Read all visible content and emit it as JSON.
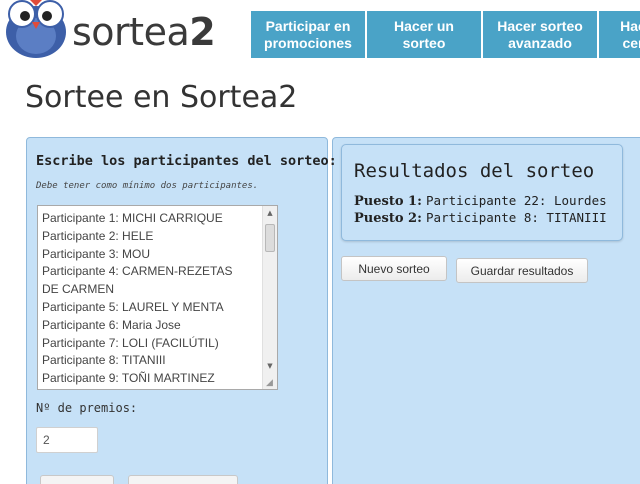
{
  "header": {
    "brand_name": "sortea",
    "brand_suffix": "2",
    "nav": [
      {
        "label": "Participar en promociones"
      },
      {
        "label": "Hacer un sorteo"
      },
      {
        "label": "Hacer sorteo avanzado"
      },
      {
        "label": "Hac cer"
      }
    ]
  },
  "page": {
    "title": "Sortee en Sortea2"
  },
  "form": {
    "heading": "Escribe los participantes del sorteo:",
    "note": "Debe tener como mínimo dos participantes.",
    "participants": [
      "Participante 1: MICHI CARRIQUE",
      "Participante 2: HELE",
      "Participante 3: MOU",
      "Participante 4: CARMEN-REZETAS",
      "DE CARMEN",
      "Participante 5: LAUREL Y MENTA",
      "Participante 6: Maria Jose",
      "Participante 7: LOLI (FACILÚTIL)",
      "Participante 8: TITANIII",
      "Participante 9: TOÑI MARTINEZ"
    ],
    "prizes_label": "Nº de premios:",
    "prizes_value": "2"
  },
  "results": {
    "title": "Resultados del sorteo",
    "items": [
      {
        "label": "Puesto 1:",
        "value": "Participante 22: Lourdes"
      },
      {
        "label": "Puesto 2:",
        "value": "Participante 8: TITANIII"
      }
    ],
    "new_button": "Nuevo sorteo",
    "save_button": "Guardar resultados"
  },
  "colors": {
    "nav_bg": "#4aa3c7",
    "panel_bg": "#c6e1f7",
    "panel_border": "#8fb9dc"
  }
}
